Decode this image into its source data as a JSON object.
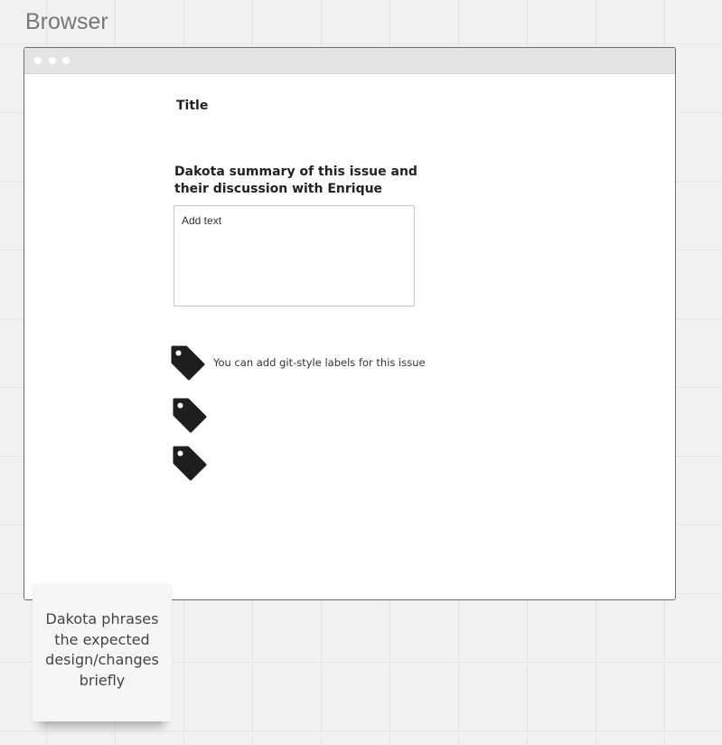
{
  "frame": {
    "label": "Browser"
  },
  "page": {
    "title": "Title",
    "summary_label": "Dakota summary of this issue and their discussion with Enrique",
    "summary_input": {
      "value": "Add text"
    },
    "labels": {
      "hint": "You can add git-style labels for this issue",
      "icons": [
        "tag-icon",
        "tag-icon",
        "tag-icon"
      ]
    }
  },
  "sticky_note": {
    "text": "Dakota phrases the expected design/changes briefly"
  },
  "colors": {
    "canvas": "#f2f2f2",
    "grid_line": "#e6e6e6",
    "titlebar": "#e4e4e4",
    "tag_icon": "#1e1e1e",
    "sticky": "#f5f6f8"
  }
}
